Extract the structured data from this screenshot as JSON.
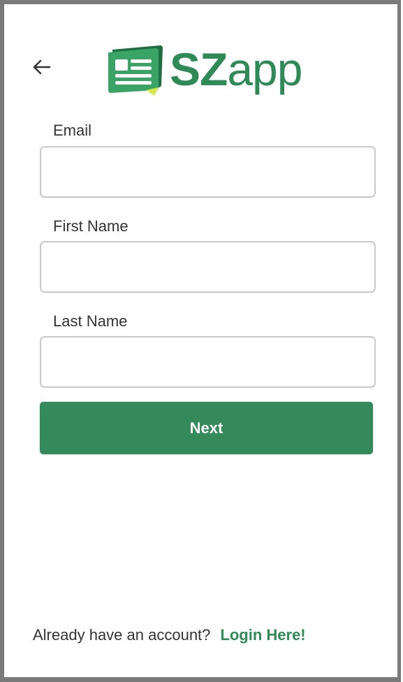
{
  "app": {
    "logo_text_bold": "SZ",
    "logo_text_light": "app"
  },
  "form": {
    "email_label": "Email",
    "email_value": "",
    "first_name_label": "First Name",
    "first_name_value": "",
    "last_name_label": "Last Name",
    "last_name_value": "",
    "next_label": "Next"
  },
  "footer": {
    "prompt": "Already have an account?",
    "login_link": "Login Here!"
  },
  "icons": {
    "back": "arrow-left-icon",
    "logo": "newspaper-logo-icon"
  },
  "colors": {
    "brand_green": "#2e8b57",
    "button_green": "#348a5a",
    "frame_gray": "#7a7a7a"
  }
}
